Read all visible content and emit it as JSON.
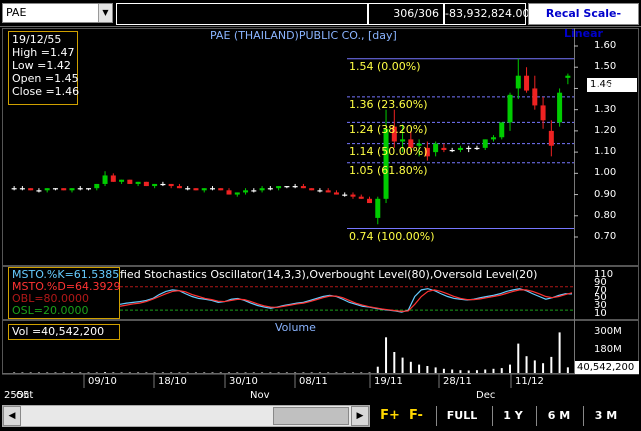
{
  "toolbar": {
    "symbol": "PAE",
    "records": "306/306",
    "value": "-83,932,824.00",
    "recal_button": "Recal Scale-Linear"
  },
  "price_panel": {
    "title": "PAE (THAILAND)PUBLIC CO., [day]",
    "info": {
      "date": "19/12/55",
      "high": "High  =1.47",
      "low": "Low   =1.42",
      "open": "Open  =1.45",
      "close": "Close =1.46"
    },
    "last_price": "1.46",
    "fib_labels": [
      "1.54 (0.00%)",
      "1.36 (23.60%)",
      "1.24 (38.20%)",
      "1.14 (50.00%)",
      "1.05 (61.80%)",
      "0.74 (100.00%)"
    ]
  },
  "stoch_panel": {
    "title": "Slow Stochastics Oscillator(14,3,3),Overbought Level(80),Oversold Level(20)",
    "title_visible": "fied Stochastics Oscillator(14,3,3),Overbought Level(80),Oversold Level(20)",
    "legend": {
      "k": "MSTO.%K",
      "k_val": "=61.5385",
      "d": "MSTO.%D",
      "d_val": "=64.3929",
      "obl": "OBL",
      "obl_val": "=80.0000",
      "osl": "OSL",
      "osl_val": "=20.0000"
    }
  },
  "volume_panel": {
    "title": "Volume",
    "legend": "Vol    =40,542,200",
    "last_value": "40,542,200"
  },
  "x_axis": {
    "dates": [
      "09/10",
      "18/10",
      "30/10",
      "08/11",
      "19/11",
      "28/11",
      "11/12"
    ],
    "months": [
      "2555",
      "Oct",
      "Nov",
      "Dec"
    ]
  },
  "bottom_bar": {
    "buttons": [
      "F+",
      "F-",
      "FULL",
      "1 Y",
      "6 M",
      "3 M"
    ]
  },
  "colors": {
    "up": "#00cc00",
    "down": "#ee2222",
    "doji": "#ffffff",
    "fib": "#7777ff",
    "stoch_k": "#66ccff",
    "stoch_d": "#ff3333",
    "info_border": "#cfa000",
    "recal_text": "#0000cc"
  },
  "chart_data": [
    {
      "type": "candlestick",
      "title": "PAE (THAILAND)PUBLIC CO., [day]",
      "ylim": [
        0.6,
        1.65
      ],
      "yticks": [
        0.7,
        0.8,
        0.9,
        1.0,
        1.1,
        1.2,
        1.3,
        1.4,
        1.5,
        1.6
      ],
      "fib_levels": [
        1.54,
        1.36,
        1.24,
        1.14,
        1.05,
        0.74
      ],
      "candles": [
        [
          0.93,
          0.94,
          0.92,
          0.93
        ],
        [
          0.93,
          0.94,
          0.92,
          0.93
        ],
        [
          0.93,
          0.93,
          0.92,
          0.92
        ],
        [
          0.92,
          0.93,
          0.91,
          0.92
        ],
        [
          0.92,
          0.93,
          0.91,
          0.93
        ],
        [
          0.93,
          0.93,
          0.92,
          0.93
        ],
        [
          0.93,
          0.93,
          0.92,
          0.92
        ],
        [
          0.92,
          0.93,
          0.91,
          0.93
        ],
        [
          0.93,
          0.94,
          0.92,
          0.93
        ],
        [
          0.93,
          0.93,
          0.92,
          0.93
        ],
        [
          0.93,
          0.95,
          0.92,
          0.95
        ],
        [
          0.95,
          1.01,
          0.94,
          0.99
        ],
        [
          0.99,
          1.0,
          0.96,
          0.96
        ],
        [
          0.96,
          0.97,
          0.95,
          0.97
        ],
        [
          0.97,
          0.97,
          0.95,
          0.95
        ],
        [
          0.95,
          0.96,
          0.94,
          0.96
        ],
        [
          0.96,
          0.96,
          0.94,
          0.94
        ],
        [
          0.94,
          0.95,
          0.93,
          0.95
        ],
        [
          0.95,
          0.96,
          0.94,
          0.95
        ],
        [
          0.95,
          0.95,
          0.93,
          0.94
        ],
        [
          0.94,
          0.95,
          0.93,
          0.93
        ],
        [
          0.93,
          0.94,
          0.92,
          0.93
        ],
        [
          0.93,
          0.93,
          0.92,
          0.92
        ],
        [
          0.92,
          0.93,
          0.91,
          0.93
        ],
        [
          0.93,
          0.94,
          0.92,
          0.93
        ],
        [
          0.93,
          0.93,
          0.92,
          0.92
        ],
        [
          0.92,
          0.93,
          0.9,
          0.9
        ],
        [
          0.9,
          0.91,
          0.89,
          0.91
        ],
        [
          0.91,
          0.93,
          0.9,
          0.92
        ],
        [
          0.92,
          0.93,
          0.91,
          0.92
        ],
        [
          0.92,
          0.94,
          0.91,
          0.93
        ],
        [
          0.93,
          0.94,
          0.92,
          0.93
        ],
        [
          0.93,
          0.94,
          0.92,
          0.94
        ],
        [
          0.94,
          0.94,
          0.93,
          0.94
        ],
        [
          0.94,
          0.95,
          0.93,
          0.94
        ],
        [
          0.94,
          0.95,
          0.93,
          0.93
        ],
        [
          0.93,
          0.93,
          0.92,
          0.92
        ],
        [
          0.92,
          0.93,
          0.91,
          0.92
        ],
        [
          0.92,
          0.93,
          0.91,
          0.91
        ],
        [
          0.91,
          0.92,
          0.9,
          0.9
        ],
        [
          0.9,
          0.91,
          0.89,
          0.9
        ],
        [
          0.9,
          0.91,
          0.88,
          0.89
        ],
        [
          0.89,
          0.9,
          0.88,
          0.88
        ],
        [
          0.88,
          0.89,
          0.86,
          0.86
        ],
        [
          0.79,
          0.89,
          0.76,
          0.88
        ],
        [
          0.88,
          1.3,
          0.86,
          1.21
        ],
        [
          1.22,
          1.3,
          1.12,
          1.15
        ],
        [
          1.15,
          1.23,
          1.1,
          1.16
        ],
        [
          1.16,
          1.2,
          1.1,
          1.12
        ],
        [
          1.13,
          1.16,
          1.08,
          1.14
        ],
        [
          1.12,
          1.15,
          1.06,
          1.08
        ],
        [
          1.1,
          1.15,
          1.08,
          1.14
        ],
        [
          1.12,
          1.14,
          1.1,
          1.11
        ],
        [
          1.11,
          1.12,
          1.1,
          1.11
        ],
        [
          1.11,
          1.13,
          1.1,
          1.12
        ],
        [
          1.12,
          1.13,
          1.1,
          1.12
        ],
        [
          1.12,
          1.13,
          1.11,
          1.12
        ],
        [
          1.12,
          1.16,
          1.11,
          1.16
        ],
        [
          1.16,
          1.18,
          1.15,
          1.17
        ],
        [
          1.17,
          1.24,
          1.16,
          1.24
        ],
        [
          1.24,
          1.38,
          1.2,
          1.37
        ],
        [
          1.4,
          1.54,
          1.35,
          1.46
        ],
        [
          1.46,
          1.5,
          1.38,
          1.39
        ],
        [
          1.4,
          1.46,
          1.3,
          1.32
        ],
        [
          1.32,
          1.36,
          1.21,
          1.25
        ],
        [
          1.2,
          1.25,
          1.08,
          1.13
        ],
        [
          1.24,
          1.4,
          1.22,
          1.38
        ],
        [
          1.45,
          1.47,
          1.42,
          1.46
        ]
      ]
    },
    {
      "type": "line",
      "title": "Slow Stochastics Oscillator(14,3,3),Overbought Level(80),Oversold Level(20)",
      "ylim": [
        0,
        110
      ],
      "yticks": [
        10,
        30,
        50,
        70,
        90,
        110
      ],
      "levels": [
        80,
        20
      ],
      "series": [
        {
          "name": "MSTO.%K",
          "values": [
            35,
            38,
            40,
            42,
            45,
            50,
            60,
            68,
            72,
            70,
            62,
            55,
            50,
            48,
            45,
            40,
            42,
            48,
            50,
            45,
            38,
            32,
            28,
            25,
            28,
            32,
            35,
            38,
            40,
            45,
            50,
            55,
            58,
            55,
            48,
            40,
            35,
            30,
            28,
            25,
            22,
            20,
            18,
            15,
            20,
            55,
            72,
            75,
            70,
            62,
            55,
            50,
            48,
            46,
            48,
            52,
            55,
            58,
            62,
            68,
            72,
            75,
            70,
            62,
            55,
            48,
            52,
            58,
            62,
            61.5
          ]
        },
        {
          "name": "MSTO.%D",
          "values": [
            30,
            33,
            36,
            38,
            42,
            48,
            55,
            62,
            68,
            70,
            67,
            60,
            55,
            50,
            47,
            43,
            42,
            45,
            48,
            47,
            42,
            36,
            31,
            28,
            27,
            30,
            33,
            36,
            38,
            42,
            47,
            52,
            56,
            56,
            52,
            45,
            38,
            33,
            29,
            26,
            23,
            21,
            19,
            17,
            18,
            35,
            55,
            68,
            72,
            68,
            62,
            55,
            50,
            47,
            47,
            49,
            52,
            55,
            58,
            63,
            68,
            72,
            72,
            68,
            62,
            55,
            52,
            55,
            60,
            64.4
          ]
        }
      ]
    },
    {
      "type": "bar",
      "title": "Volume",
      "yticks_label": [
        "180M",
        "300M"
      ],
      "values": [
        2,
        1,
        2,
        1,
        2,
        1,
        1,
        2,
        1,
        2,
        1,
        6,
        4,
        2,
        2,
        1,
        2,
        1,
        2,
        1,
        2,
        1,
        1,
        2,
        1,
        1,
        2,
        1,
        2,
        1,
        2,
        1,
        2,
        1,
        2,
        1,
        1,
        2,
        1,
        2,
        1,
        2,
        1,
        3,
        45,
        255,
        150,
        110,
        80,
        60,
        50,
        40,
        30,
        25,
        20,
        18,
        20,
        25,
        30,
        35,
        60,
        210,
        120,
        90,
        70,
        115,
        290,
        40.5
      ]
    }
  ]
}
